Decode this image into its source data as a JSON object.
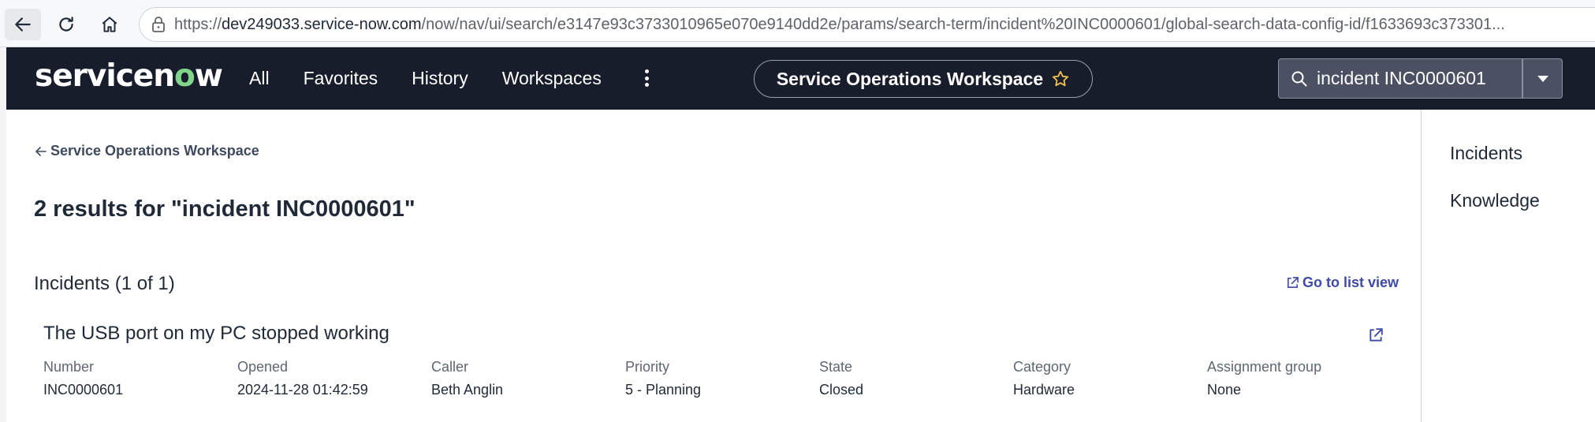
{
  "browser": {
    "url_prefix": "https://",
    "url_host": "dev249033.service-now.com",
    "url_path": "/now/nav/ui/search/e3147e93c3733010965e070e9140dd2e/params/search-term/incident%20INC0000601/global-search-data-config-id/f1633693c373301..."
  },
  "header": {
    "logo_text_a": "servicen",
    "logo_text_o": "o",
    "logo_text_b": "w",
    "menu": [
      "All",
      "Favorites",
      "History",
      "Workspaces"
    ],
    "workspace_label": "Service Operations Workspace",
    "search_value": "incident INC0000601"
  },
  "main": {
    "back_link": "Service Operations Workspace",
    "results_title": "2 results for \"incident INC0000601\"",
    "section_title": "Incidents (1 of 1)",
    "list_link": "Go to list view",
    "record": {
      "title": "The USB port on my PC stopped working",
      "fields": [
        {
          "label": "Number",
          "value": "INC0000601"
        },
        {
          "label": "Opened",
          "value": "2024-11-28 01:42:59"
        },
        {
          "label": "Caller",
          "value": "Beth Anglin"
        },
        {
          "label": "Priority",
          "value": "5 - Planning"
        },
        {
          "label": "State",
          "value": "Closed"
        },
        {
          "label": "Category",
          "value": "Hardware"
        },
        {
          "label": "Assignment group",
          "value": "None"
        }
      ]
    }
  },
  "right_panel": {
    "items": [
      "Incidents",
      "Knowledge"
    ]
  },
  "colors": {
    "appbar": "#181d2b",
    "logo_accent": "#81d58a",
    "link": "#3e49a8",
    "star": "#f2c14e"
  }
}
